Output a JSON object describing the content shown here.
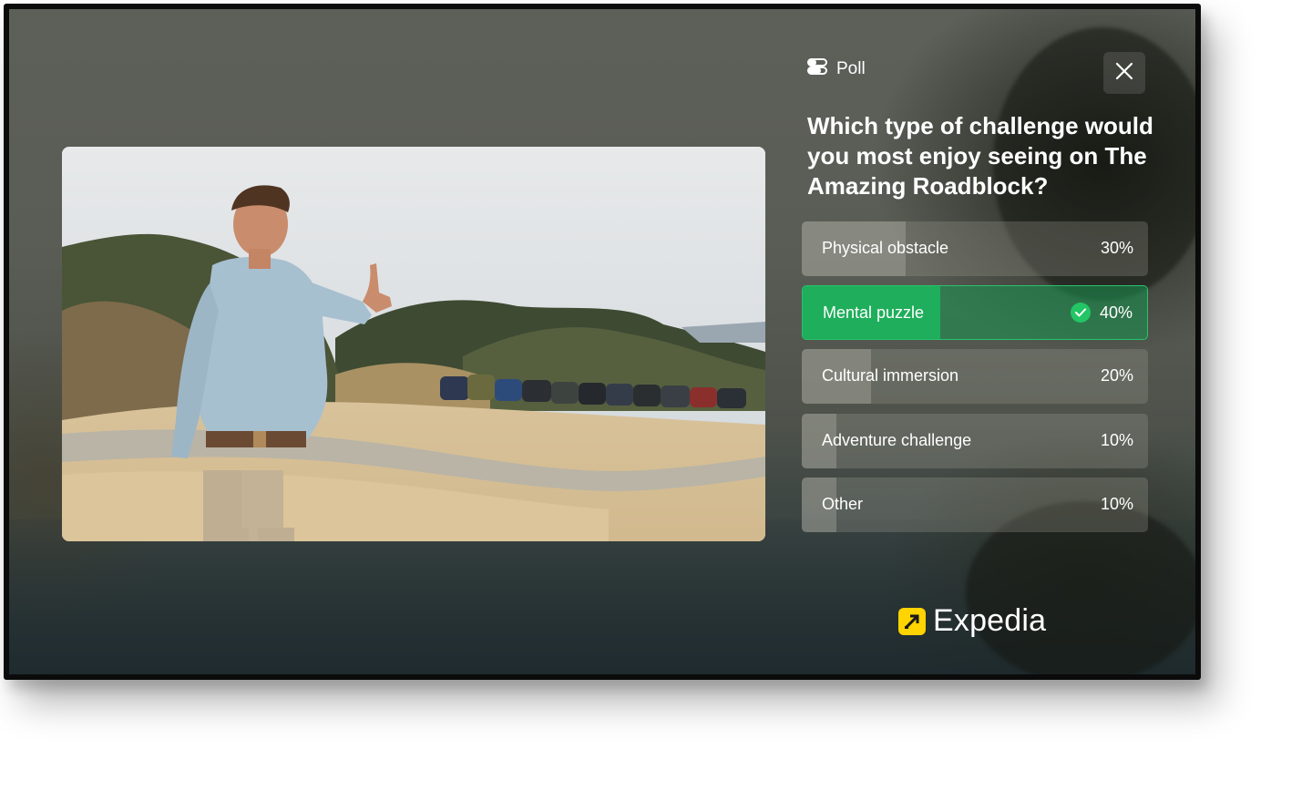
{
  "poll": {
    "label": "Poll",
    "question": "Which type of challenge would you most enjoy seeing on The Amazing Roadblock?",
    "options": [
      {
        "label": "Physical obstacle",
        "percent_text": "30%",
        "share": 0.3,
        "selected": false
      },
      {
        "label": "Mental puzzle",
        "percent_text": "40%",
        "share": 0.4,
        "selected": true
      },
      {
        "label": "Cultural immersion",
        "percent_text": "20%",
        "share": 0.2,
        "selected": false
      },
      {
        "label": "Adventure challenge",
        "percent_text": "10%",
        "share": 0.1,
        "selected": false
      },
      {
        "label": "Other",
        "percent_text": "10%",
        "share": 0.1,
        "selected": false
      }
    ]
  },
  "brand": {
    "name": "Expedia",
    "logo": "expedia-logo",
    "accent": "#FFD400"
  },
  "colors": {
    "selected": "#1FAE5B",
    "check": "#23C565"
  },
  "icons": {
    "poll": "poll-icon",
    "close": "close-icon",
    "check": "check-icon"
  }
}
